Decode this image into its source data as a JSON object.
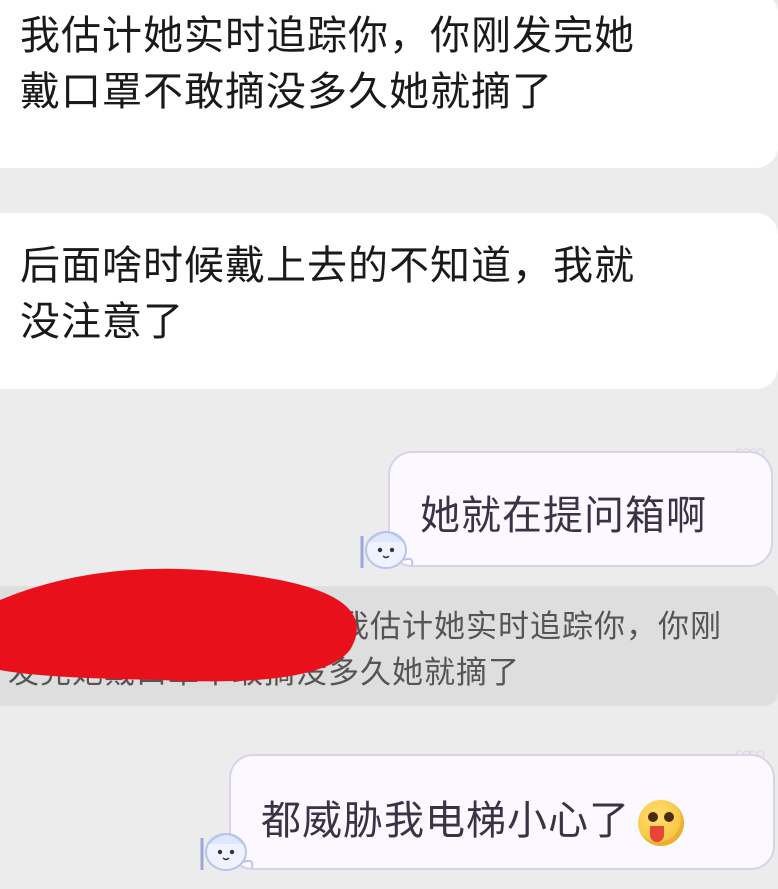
{
  "messages": [
    {
      "side": "left",
      "text_line1": "我估计她实时追踪你，你刚发完她",
      "text_line2": "戴口罩不敢摘没多久她就摘了"
    },
    {
      "side": "left",
      "text_line1": "后面啥时候戴上去的不知道，我就",
      "text_line2": "没注意了"
    },
    {
      "side": "right",
      "text": "她就在提问箱啊"
    },
    {
      "side": "right",
      "text": "都威胁我电梯小心了",
      "emoji": "tongue-out-face-emoji"
    }
  ],
  "quote": {
    "line1": "我估计她实时追踪你，你刚",
    "line2": "发完她戴口罩不敢摘没多久她就摘了"
  },
  "colors": {
    "background": "#ececec",
    "left_bubble": "#ffffff",
    "right_bubble": "#fbf9ff",
    "right_border": "#d9d2ea",
    "redaction": "#e8101a"
  }
}
